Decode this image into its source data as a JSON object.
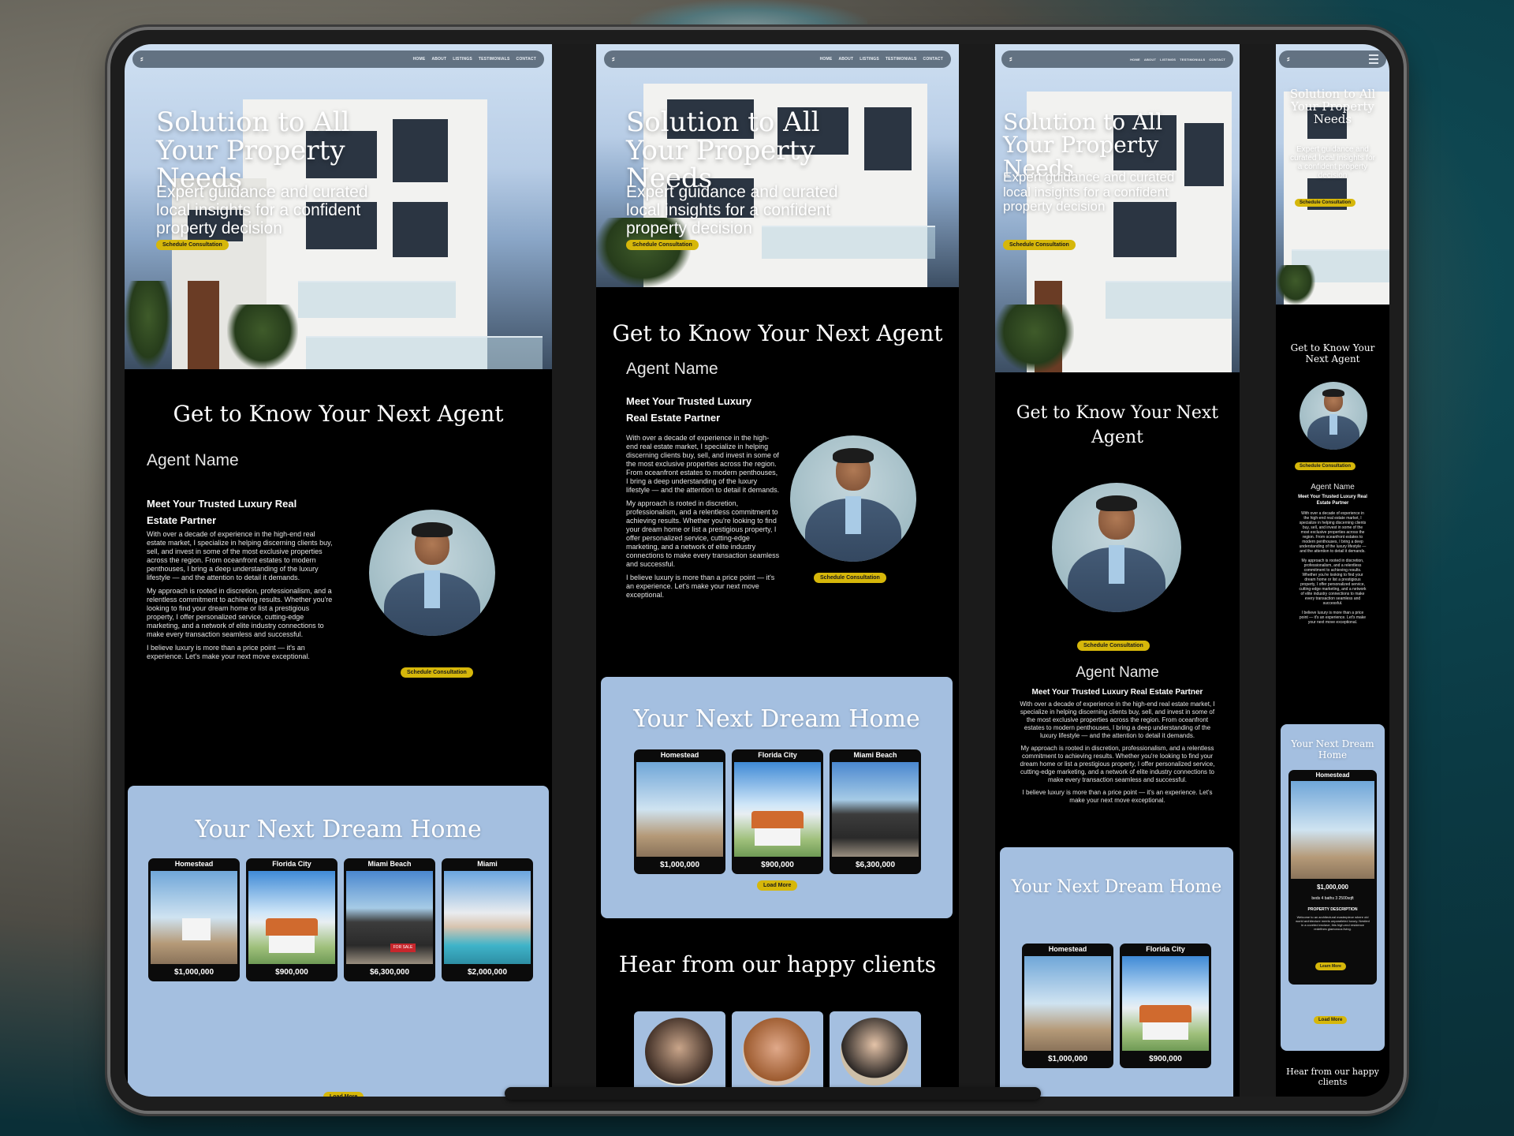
{
  "nav": {
    "logo": "⸗",
    "links": [
      "HOME",
      "ABOUT",
      "LISTINGS",
      "TESTIMONIALS",
      "CONTACT"
    ]
  },
  "hero": {
    "title": "Solution to All Your Property Needs",
    "subtitle": "Expert guidance and curated local insights for a confident property decision",
    "cta": "Schedule Consultation"
  },
  "agent": {
    "section_title": "Get to Know Your Next Agent",
    "name": "Agent Name",
    "tagline": "Meet Your Trusted Luxury Real Estate Partner",
    "bio_1": "With over a decade of experience in the high-end real estate market, I specialize in helping discerning clients buy, sell, and invest in some of the most exclusive properties across the region. From oceanfront estates to modern penthouses, I bring a deep understanding of the luxury lifestyle — and the attention to detail it demands.",
    "bio_2": "My approach is rooted in discretion, professionalism, and a relentless commitment to achieving results. Whether you're looking to find your dream home or list a prestigious property, I offer personalized service, cutting-edge marketing, and a network of elite industry connections to make every transaction seamless and successful.",
    "bio_3": "I believe luxury is more than a price point — it's an experience. Let's make your next move exceptional.",
    "cta": "Schedule Consultation"
  },
  "listings": {
    "title": "Your Next Dream Home",
    "items": [
      {
        "name": "Homestead",
        "price": "$1,000,000"
      },
      {
        "name": "Florida City",
        "price": "$900,000"
      },
      {
        "name": "Miami Beach",
        "price": "$6,300,000"
      },
      {
        "name": "Miami",
        "price": "$2,000,000"
      }
    ],
    "load_more": "Load More",
    "mobile_details": {
      "specs": "beds 4  baths 3  2500sqft",
      "heading": "PROPERTY DESCRIPTION",
      "text": "Welcome to an architectural masterpiece where old world architecture meets unparalleled luxury. Nestled in a coveted enclave, this high-end residence redefines glamorous living.",
      "cta": "Learn More"
    },
    "sale_sign": "FOR SALE"
  },
  "clients": {
    "title": "Hear from our happy  clients",
    "title_mobile": "Hear from our happy clients"
  },
  "colors": {
    "accent": "#d6b70a",
    "listing_bg": "#a4bfe0",
    "page_bg": "#000000"
  }
}
